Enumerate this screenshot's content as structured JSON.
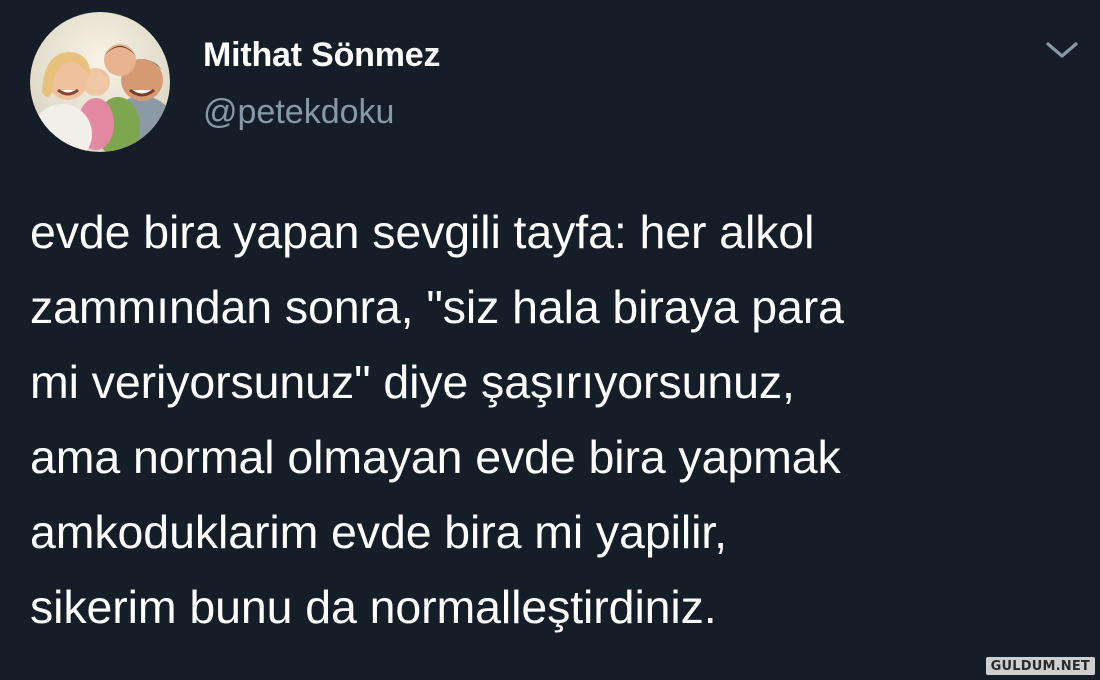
{
  "author": {
    "display_name": "Mithat Sönmez",
    "handle": "@petekdoku",
    "avatar_icon": "family-photo-avatar"
  },
  "header": {
    "menu_icon": "chevron-down-icon"
  },
  "tweet": {
    "lines": [
      "evde bira yapan sevgili tayfa: her alkol",
      "zammından sonra, \"siz hala biraya para",
      "mi veriyorsunuz\" diye şaşırıyorsunuz,",
      "ama normal olmayan evde bira yapmak",
      "amkoduklarim evde bira mi yapilir,",
      "sikerim bunu da normalleştirdiniz."
    ]
  },
  "watermark": {
    "text": "GULDUM.NET"
  },
  "colors": {
    "background": "#151d28",
    "text": "#ffffff",
    "secondary_text": "#8899a6"
  }
}
